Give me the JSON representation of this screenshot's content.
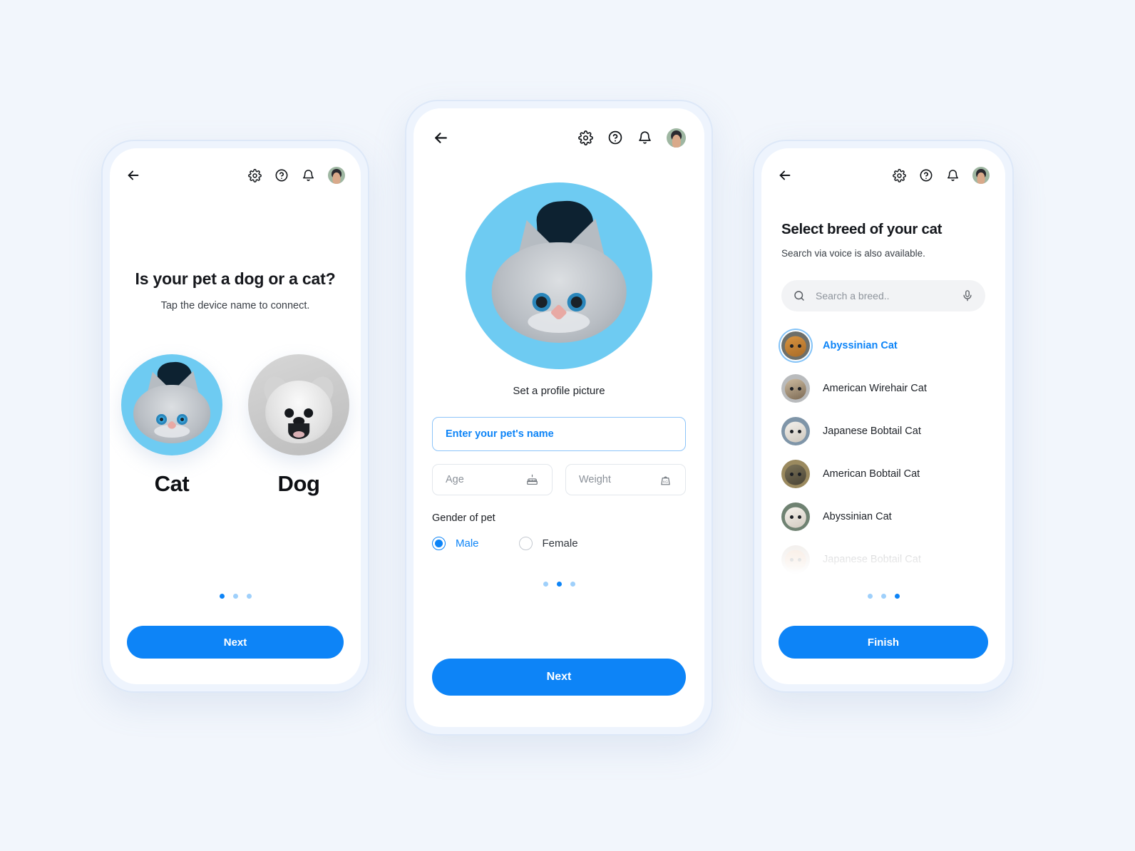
{
  "colors": {
    "page_background": "#f2f6fc",
    "accent_blue": "#0d84f7",
    "accent_blue_light": "#9fd0fb",
    "cat_circle_blue": "#6ecbf2",
    "dog_circle_gray": "#cccccc",
    "text_primary": "#16181d",
    "text_secondary": "#3a4047",
    "field_border": "#e3e7ec",
    "field_border_focus": "#8dc4f9",
    "search_background": "#f2f3f5",
    "phone_frame": "#dde8f8"
  },
  "screen_1": {
    "header": {
      "back_icon": "arrow-left-icon",
      "settings_icon": "gear-icon",
      "help_icon": "question-circle-icon",
      "notifications_icon": "bell-icon",
      "avatar_icon": "user-avatar"
    },
    "title": "Is your pet a dog or a cat?",
    "subtitle": "Tap the device name to connect.",
    "options": [
      {
        "label": "Cat",
        "icon": "cat-photo",
        "selected": true
      },
      {
        "label": "Dog",
        "icon": "dog-photo",
        "selected": false
      }
    ],
    "pagination": {
      "count": 3,
      "active_index": 0
    },
    "primary_button": "Next"
  },
  "screen_2": {
    "header": {
      "back_icon": "arrow-left-icon",
      "settings_icon": "gear-icon",
      "help_icon": "question-circle-icon",
      "notifications_icon": "bell-icon",
      "avatar_icon": "user-avatar"
    },
    "profile_picture": {
      "icon": "cat-photo",
      "caption": "Set a profile picture"
    },
    "fields": {
      "name": {
        "placeholder": "Enter your pet's name",
        "value": "",
        "focused": true
      },
      "age": {
        "placeholder": "Age",
        "value": "",
        "icon": "birthday-cake-icon"
      },
      "weight": {
        "placeholder": "Weight",
        "value": "",
        "icon": "weight-kg-icon"
      }
    },
    "gender": {
      "label": "Gender of pet",
      "options": [
        {
          "label": "Male",
          "selected": true
        },
        {
          "label": "Female",
          "selected": false
        }
      ]
    },
    "pagination": {
      "count": 3,
      "active_index": 1
    },
    "primary_button": "Next"
  },
  "screen_3": {
    "header": {
      "back_icon": "arrow-left-icon",
      "settings_icon": "gear-icon",
      "help_icon": "question-circle-icon",
      "notifications_icon": "bell-icon",
      "avatar_icon": "user-avatar"
    },
    "title": "Select breed of your cat",
    "subtitle": "Search via voice is also available.",
    "search": {
      "placeholder": "Search a breed..",
      "value": "",
      "search_icon": "search-icon",
      "voice_icon": "microphone-icon"
    },
    "breeds": [
      {
        "name": "Abyssinian Cat",
        "selected": true,
        "faded": false,
        "thumb": "t1"
      },
      {
        "name": "American Wirehair Cat",
        "selected": false,
        "faded": false,
        "thumb": "t2"
      },
      {
        "name": "Japanese Bobtail Cat",
        "selected": false,
        "faded": false,
        "thumb": "t3"
      },
      {
        "name": "American Bobtail Cat",
        "selected": false,
        "faded": false,
        "thumb": "t4"
      },
      {
        "name": "Abyssinian Cat",
        "selected": false,
        "faded": false,
        "thumb": "t5"
      },
      {
        "name": "Japanese Bobtail Cat",
        "selected": false,
        "faded": true,
        "thumb": "t6"
      }
    ],
    "pagination": {
      "count": 3,
      "active_index": 2
    },
    "primary_button": "Finish"
  }
}
